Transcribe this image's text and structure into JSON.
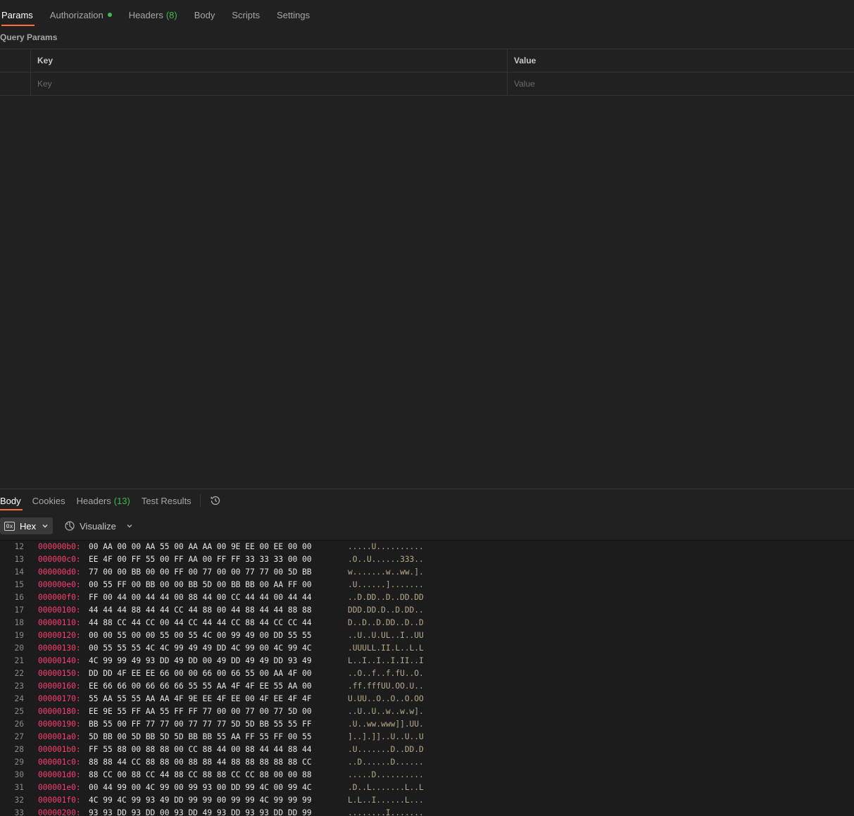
{
  "request_tabs": [
    {
      "label": "Params",
      "active": true
    },
    {
      "label": "Authorization",
      "dot": true
    },
    {
      "label": "Headers",
      "count": "(8)"
    },
    {
      "label": "Body"
    },
    {
      "label": "Scripts"
    },
    {
      "label": "Settings"
    }
  ],
  "query_params": {
    "title": "Query Params",
    "head": {
      "key": "Key",
      "value": "Value"
    },
    "placeholder": {
      "key": "Key",
      "value": "Value"
    }
  },
  "response_tabs": [
    {
      "label": "Body",
      "active": true
    },
    {
      "label": "Cookies"
    },
    {
      "label": "Headers",
      "count": "(13)"
    },
    {
      "label": "Test Results"
    }
  ],
  "toolbar": {
    "format_icon": "0x",
    "format_label": "Hex",
    "visualize_label": "Visualize"
  },
  "colors": {
    "accent": "#ff6c37",
    "count_green": "#3fb950",
    "address_pink": "#ff3d71"
  },
  "hex_lines": [
    {
      "ln": "12",
      "addr": "000000b0:",
      "bytes": "00 AA 00 00 AA 55 00 AA AA 00 9E EE 00 EE 00 00",
      "ascii": ".....U.........."
    },
    {
      "ln": "13",
      "addr": "000000c0:",
      "bytes": "EE 4F 00 FF 55 00 FF AA 00 FF FF 33 33 33 00 00",
      "ascii": ".O..U......333.."
    },
    {
      "ln": "14",
      "addr": "000000d0:",
      "bytes": "77 00 00 BB 00 00 FF 00 77 00 00 77 77 00 5D BB",
      "ascii": "w.......w..ww.]."
    },
    {
      "ln": "15",
      "addr": "000000e0:",
      "bytes": "00 55 FF 00 BB 00 00 BB 5D 00 BB BB 00 AA FF 00",
      "ascii": ".U......]......."
    },
    {
      "ln": "16",
      "addr": "000000f0:",
      "bytes": "FF 00 44 00 44 44 00 88 44 00 CC 44 44 00 44 44",
      "ascii": "..D.DD..D..DD.DD"
    },
    {
      "ln": "17",
      "addr": "00000100:",
      "bytes": "44 44 44 88 44 44 CC 44 88 00 44 88 44 44 88 88",
      "ascii": "DDD.DD.D..D.DD.."
    },
    {
      "ln": "18",
      "addr": "00000110:",
      "bytes": "44 88 CC 44 CC 00 44 CC 44 44 CC 88 44 CC CC 44",
      "ascii": "D..D..D.DD..D..D"
    },
    {
      "ln": "19",
      "addr": "00000120:",
      "bytes": "00 00 55 00 00 55 00 55 4C 00 99 49 00 DD 55 55",
      "ascii": "..U..U.UL..I..UU"
    },
    {
      "ln": "20",
      "addr": "00000130:",
      "bytes": "00 55 55 55 4C 4C 99 49 49 DD 4C 99 00 4C 99 4C",
      "ascii": ".UUULL.II.L..L.L"
    },
    {
      "ln": "21",
      "addr": "00000140:",
      "bytes": "4C 99 99 49 93 DD 49 DD 00 49 DD 49 49 DD 93 49",
      "ascii": "L..I..I..I.II..I"
    },
    {
      "ln": "22",
      "addr": "00000150:",
      "bytes": "DD DD 4F EE EE 66 00 00 66 00 66 55 00 AA 4F 00",
      "ascii": "..O..f..f.fU..O."
    },
    {
      "ln": "23",
      "addr": "00000160:",
      "bytes": "EE 66 66 00 66 66 66 55 55 AA 4F 4F EE 55 AA 00",
      "ascii": ".ff.fffUU.OO.U.."
    },
    {
      "ln": "24",
      "addr": "00000170:",
      "bytes": "55 AA 55 55 AA AA 4F 9E EE 4F EE 00 4F EE 4F 4F",
      "ascii": "U.UU..O..O..O.OO"
    },
    {
      "ln": "25",
      "addr": "00000180:",
      "bytes": "EE 9E 55 FF AA 55 FF FF 77 00 00 77 00 77 5D 00",
      "ascii": "..U..U..w..w.w]."
    },
    {
      "ln": "26",
      "addr": "00000190:",
      "bytes": "BB 55 00 FF 77 77 00 77 77 77 5D 5D BB 55 55 FF",
      "ascii": ".U..ww.www]].UU."
    },
    {
      "ln": "27",
      "addr": "000001a0:",
      "bytes": "5D BB 00 5D BB 5D 5D BB BB 55 AA FF 55 FF 00 55",
      "ascii": "]..].]]..U..U..U"
    },
    {
      "ln": "28",
      "addr": "000001b0:",
      "bytes": "FF 55 88 00 88 88 00 CC 88 44 00 88 44 44 88 44",
      "ascii": ".U.......D..DD.D"
    },
    {
      "ln": "29",
      "addr": "000001c0:",
      "bytes": "88 88 44 CC 88 88 00 88 88 44 88 88 88 88 88 CC",
      "ascii": "..D......D......"
    },
    {
      "ln": "30",
      "addr": "000001d0:",
      "bytes": "88 CC 00 88 CC 44 88 CC 88 88 CC CC 88 00 00 88",
      "ascii": ".....D.........."
    },
    {
      "ln": "31",
      "addr": "000001e0:",
      "bytes": "00 44 99 00 4C 99 00 99 93 00 DD 99 4C 00 99 4C",
      "ascii": ".D..L.......L..L"
    },
    {
      "ln": "32",
      "addr": "000001f0:",
      "bytes": "4C 99 4C 99 93 49 DD 99 99 00 99 99 4C 99 99 99",
      "ascii": "L.L..I......L..."
    },
    {
      "ln": "33",
      "addr": "00000200:",
      "bytes": "93 93 DD 93 DD 00 93 DD 49 93 DD 93 93 DD DD 99",
      "ascii": "........I......."
    }
  ]
}
